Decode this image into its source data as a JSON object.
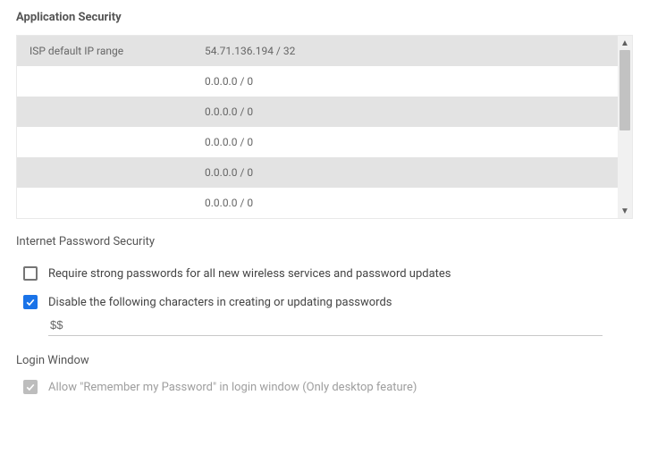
{
  "app_security": {
    "title": "Application Security",
    "rows": [
      {
        "name": "ISP default IP range",
        "value": "54.71.136.194 / 32"
      },
      {
        "name": "",
        "value": "0.0.0.0 / 0"
      },
      {
        "name": "",
        "value": "0.0.0.0 / 0"
      },
      {
        "name": "",
        "value": "0.0.0.0 / 0"
      },
      {
        "name": "",
        "value": "0.0.0.0 / 0"
      },
      {
        "name": "",
        "value": "0.0.0.0 / 0"
      }
    ]
  },
  "pw_security": {
    "title": "Internet Password Security",
    "require_strong": {
      "checked": false,
      "label": "Require strong passwords for all new wireless services and password updates"
    },
    "disable_chars": {
      "checked": true,
      "label": "Disable the following characters in creating or updating passwords",
      "value": "$$"
    }
  },
  "login_window": {
    "title": "Login Window",
    "remember": {
      "checked": true,
      "disabled": true,
      "label": "Allow \"Remember my Password\" in login window (Only desktop feature)"
    }
  }
}
